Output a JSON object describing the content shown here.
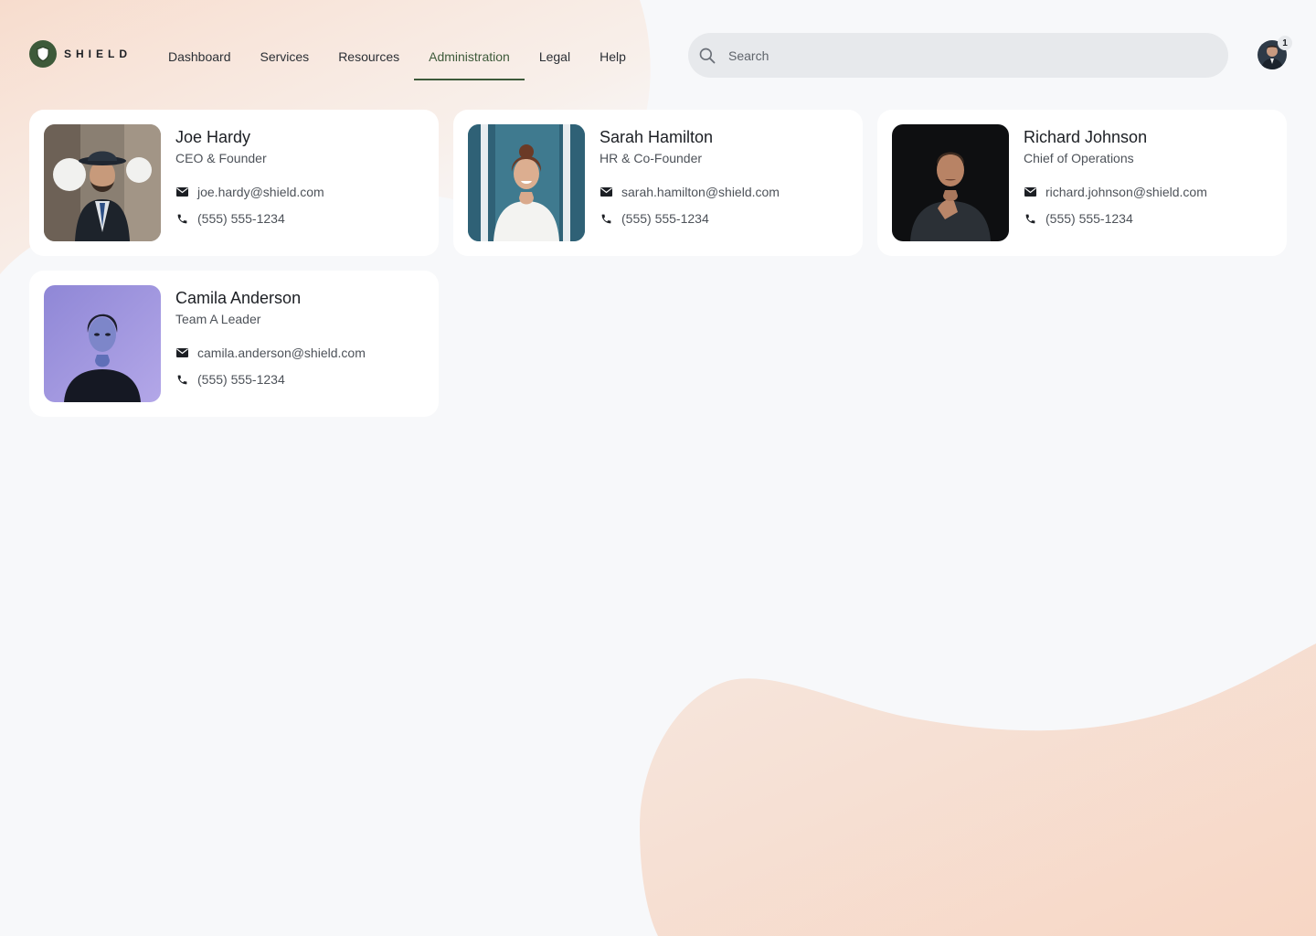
{
  "brand": {
    "name": "SHIELD",
    "accent_color": "#3d5a3a"
  },
  "nav": {
    "items": [
      {
        "label": "Dashboard"
      },
      {
        "label": "Services"
      },
      {
        "label": "Resources"
      },
      {
        "label": "Administration",
        "active": true
      },
      {
        "label": "Legal"
      },
      {
        "label": "Help"
      }
    ]
  },
  "search": {
    "placeholder": "Search",
    "value": ""
  },
  "user": {
    "notification_count": "1",
    "avatar_icon": "user-avatar"
  },
  "contacts": [
    {
      "name": "Joe Hardy",
      "role": "CEO & Founder",
      "email": "joe.hardy@shield.com",
      "phone": "(555) 555-1234"
    },
    {
      "name": "Sarah Hamilton",
      "role": "HR & Co-Founder",
      "email": "sarah.hamilton@shield.com",
      "phone": "(555) 555-1234"
    },
    {
      "name": "Richard Johnson",
      "role": "Chief of Operations",
      "email": "richard.johnson@shield.com",
      "phone": "(555) 555-1234"
    },
    {
      "name": "Camila Anderson",
      "role": "Team A Leader",
      "email": "camila.anderson@shield.com",
      "phone": "(555) 555-1234"
    }
  ],
  "icons": {
    "email": "envelope-icon",
    "phone": "phone-icon",
    "search": "search-icon",
    "logo": "shield-icon"
  }
}
